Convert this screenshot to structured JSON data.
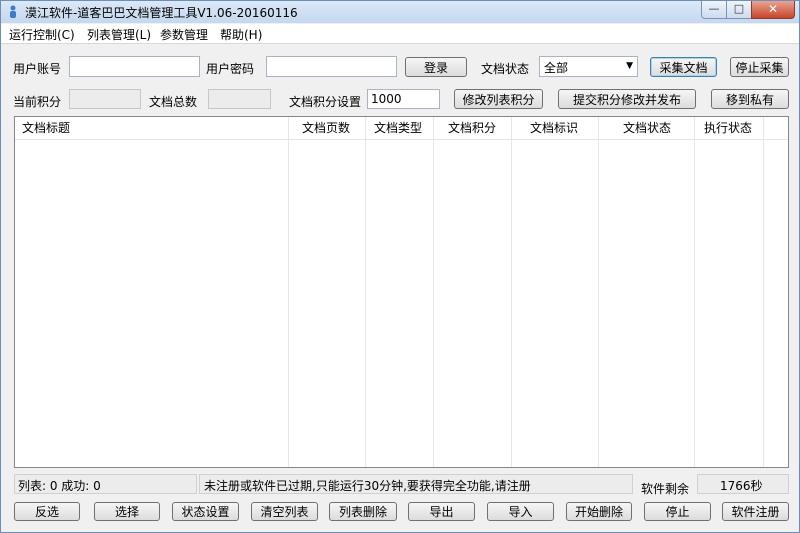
{
  "window": {
    "title": "漠江软件-道客巴巴文档管理工具V1.06-20160116"
  },
  "menu": [
    {
      "label": "运行控制(C)"
    },
    {
      "label": "列表管理(L)"
    },
    {
      "label": "参数管理"
    },
    {
      "label": "帮助(H)"
    }
  ],
  "login": {
    "account_label": "用户账号",
    "account_value": "",
    "password_label": "用户密码",
    "password_value": "",
    "login_button": "登录",
    "doc_status_label": "文档状态",
    "doc_status_value": "全部",
    "collect_button": "采集文档",
    "stop_collect_button": "停止采集"
  },
  "points": {
    "current_label": "当前积分",
    "current_value": "",
    "total_docs_label": "文档总数",
    "total_docs_value": "",
    "points_setting_label": "文档积分设置",
    "points_setting_value": "1000",
    "modify_list_points_button": "修改列表积分",
    "submit_publish_button": "提交积分修改并发布",
    "move_private_button": "移到私有"
  },
  "table": {
    "columns": [
      "文档标题",
      "文档页数",
      "文档类型",
      "文档积分",
      "文档标识",
      "文档状态",
      "执行状态"
    ],
    "rows": []
  },
  "status": {
    "summary": "列表: 0 成功: 0",
    "message": "未注册或软件已过期,只能运行30分钟,要获得完全功能,请注册",
    "remaining_label": "软件剩余",
    "remaining_value": "1766秒"
  },
  "bottom_buttons": [
    {
      "label": "反选"
    },
    {
      "label": "选择"
    },
    {
      "label": "状态设置"
    },
    {
      "label": "清空列表"
    },
    {
      "label": "列表删除"
    },
    {
      "label": "导出"
    },
    {
      "label": "导入"
    },
    {
      "label": "开始删除"
    },
    {
      "label": "停止"
    },
    {
      "label": "软件注册"
    }
  ]
}
